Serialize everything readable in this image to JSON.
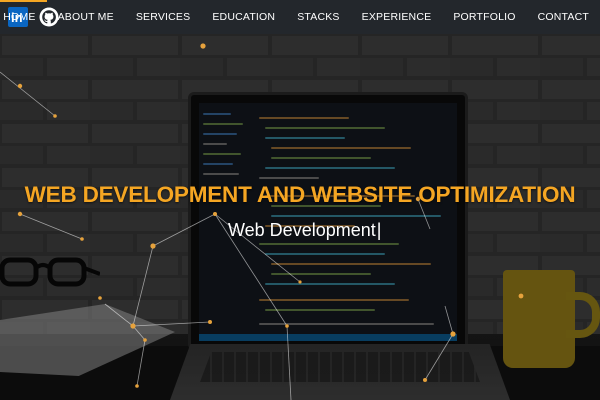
{
  "brand": {
    "linkedin": {
      "icon": "linkedin-icon",
      "label": "in",
      "color": "#0a66c2"
    },
    "github": {
      "icon": "github-icon",
      "color": "#ffffff"
    }
  },
  "nav": {
    "items": [
      {
        "label": "HOME",
        "active": true
      },
      {
        "label": "ABOUT ME"
      },
      {
        "label": "SERVICES"
      },
      {
        "label": "EDUCATION"
      },
      {
        "label": "STACKS"
      },
      {
        "label": "EXPERIENCE"
      },
      {
        "label": "PORTFOLIO"
      },
      {
        "label": "CONTACT"
      }
    ],
    "active_color": "#f5a623"
  },
  "hero": {
    "title": "WEB DEVELOPMENT AND WEBSITE OPTIMIZATION",
    "typed_text": "Web Development",
    "cursor": "|",
    "title_color": "#f5a623"
  }
}
